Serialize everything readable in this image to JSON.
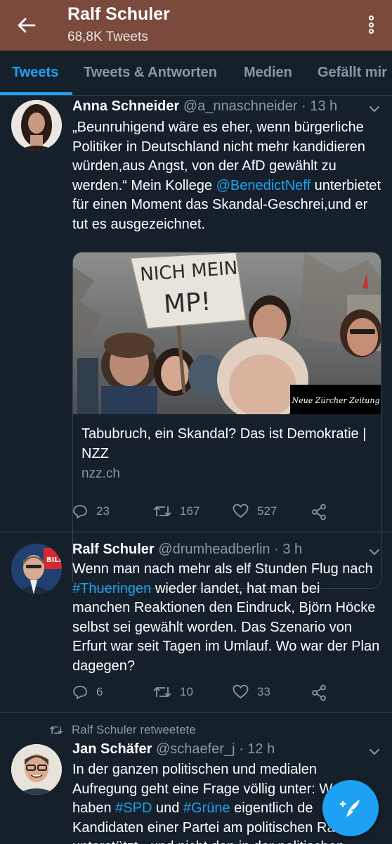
{
  "header": {
    "title": "Ralf Schuler",
    "subtitle": "68,8K Tweets",
    "back_icon": "arrow-left-icon",
    "more_icon": "more-vertical-icon",
    "color": "#7a4a3c"
  },
  "tabs": [
    {
      "label": "Tweets",
      "active": true
    },
    {
      "label": "Tweets & Antworten",
      "active": false
    },
    {
      "label": "Medien",
      "active": false
    },
    {
      "label": "Gefällt mir",
      "active": false
    }
  ],
  "tweets": [
    {
      "name": "Anna Schneider",
      "handle": "@a_nnaschneider · 13 h",
      "text_1": "„Beunruhigend wäre es eher, wenn bürgerliche Politiker in Deutschland nicht mehr kandidieren würden,aus Angst, von der AfD gewählt zu werden.“ Mein Kollege ",
      "mention": "@BenedictNeff",
      "text_2": " unterbietet für einen Moment das Skandal-Geschrei,und er tut es ausgezeichnet.",
      "card": {
        "sign_line1": "NICH MEIN",
        "sign_line2": "MP!",
        "watermark": "Neue Zürcher Zeitung",
        "title": "Tabubruch, ein Skandal? Das ist Demokratie | NZZ",
        "domain": "nzz.ch"
      },
      "replies": "23",
      "retweets": "167",
      "likes": "527"
    },
    {
      "name": "Ralf Schuler",
      "handle": "@drumheadberlin · 3 h",
      "text_1": "Wenn man nach mehr als elf Stunden Flug nach ",
      "hashtag": "#Thueringen",
      "text_2": " wieder landet, hat man bei manchen Reaktionen den Eindruck, Björn Höcke selbst sei gewählt worden. Das Szenario von Erfurt war seit Tagen im Umlauf. Wo war der Plan dagegen?",
      "replies": "6",
      "retweets": "10",
      "likes": "33"
    },
    {
      "retweeted_by": "Ralf Schuler retweetete",
      "name": "Jan Schäfer",
      "handle": "@schaefer_j · 12 h",
      "text_1": "In der ganzen politischen und medialen Aufregung geht eine Frage völlig unter: W",
      "text_1b": "m haben ",
      "hashtag_1": "#SPD",
      "text_2": " und ",
      "hashtag_2": "#Grüne",
      "text_3": " eigentlich de",
      "text_4": "Kandidaten einer Partei am politischen R",
      "text_4b": "a unterstützt - und nicht den in der politischen"
    }
  ],
  "fab": {
    "icon": "compose-feather-icon",
    "color": "#1da1f2"
  },
  "colors": {
    "background": "#15202b",
    "accent": "#1da1f2",
    "secondary_text": "#8899a6",
    "divider": "#38444d"
  }
}
